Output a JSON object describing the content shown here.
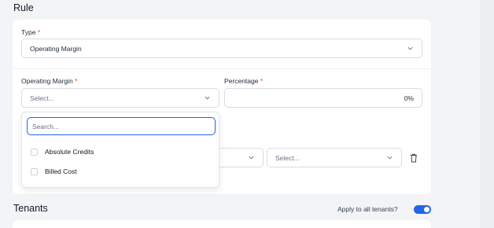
{
  "rule": {
    "title": "Rule",
    "type_label": "Type",
    "type_value": "Operating Margin",
    "operating_margin_label": "Operating Margin",
    "operating_margin_placeholder": "Select...",
    "percentage_label": "Percentage",
    "percentage_value": "0%",
    "required_mark": "*",
    "row2_select_placeholder": "Select..."
  },
  "dropdown": {
    "search_placeholder": "Search...",
    "options": [
      {
        "label": "Absolute Credits",
        "checked": false
      },
      {
        "label": "Billed Cost",
        "checked": false
      }
    ]
  },
  "tenants": {
    "title": "Tenants",
    "apply_all_label": "Apply to all tenants?",
    "apply_all_on": true
  },
  "colors": {
    "accent": "#2563eb",
    "required": "#ef4444"
  },
  "icons": [
    "chevron-down-icon",
    "trash-icon"
  ]
}
